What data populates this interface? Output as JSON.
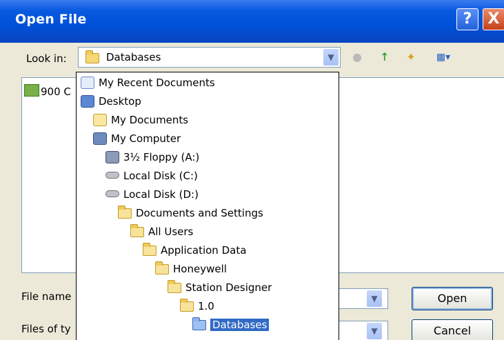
{
  "window": {
    "title": "Open File"
  },
  "titlebar_buttons": {
    "help": "?",
    "close": "X"
  },
  "lookin": {
    "label": "Look in:",
    "value": "Databases"
  },
  "file_list": [
    {
      "name": "900 C"
    }
  ],
  "dropdown_items": [
    {
      "label": "My Recent Documents",
      "icon": "recent-documents-icon"
    },
    {
      "label": "Desktop",
      "icon": "desktop-icon"
    },
    {
      "label": "My Documents",
      "icon": "my-documents-icon"
    },
    {
      "label": "My Computer",
      "icon": "my-computer-icon"
    },
    {
      "label": "3½ Floppy (A:)",
      "icon": "floppy-drive-icon"
    },
    {
      "label": "Local Disk (C:)",
      "icon": "hard-disk-icon"
    },
    {
      "label": "Local Disk (D:)",
      "icon": "hard-disk-icon"
    },
    {
      "label": "Documents and Settings",
      "icon": "folder-icon"
    },
    {
      "label": "All Users",
      "icon": "folder-icon"
    },
    {
      "label": "Application Data",
      "icon": "folder-icon"
    },
    {
      "label": "Honeywell",
      "icon": "folder-icon"
    },
    {
      "label": "Station Designer",
      "icon": "folder-icon"
    },
    {
      "label": "1.0",
      "icon": "folder-icon"
    },
    {
      "label": "Databases",
      "icon": "folder-icon",
      "selected": true
    }
  ],
  "filename": {
    "label": "File name",
    "value": ""
  },
  "filetype": {
    "label": "Files of ty",
    "value": ""
  },
  "buttons": {
    "open": "Open",
    "cancel": "Cancel"
  },
  "colors": {
    "titlebar": "#0050d8",
    "selection": "#316ac5",
    "dialog_bg": "#ece9d8"
  }
}
